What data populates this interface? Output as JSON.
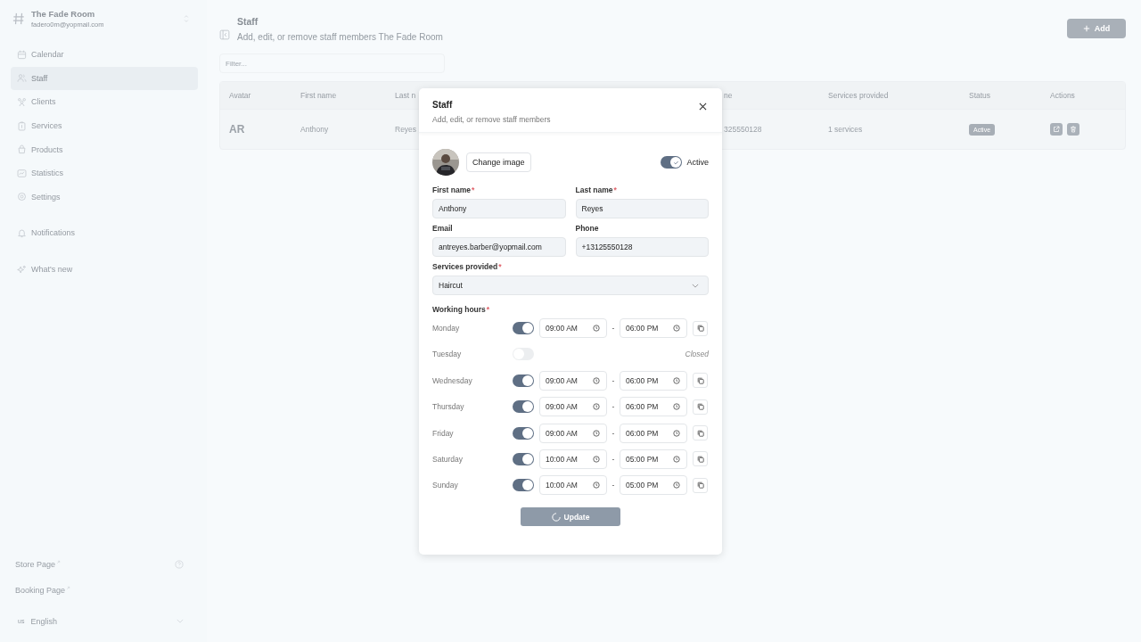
{
  "workspace": {
    "name": "The Fade Room",
    "email": "fadero0m@yopmail.com"
  },
  "sidebar": {
    "items": [
      {
        "label": "Calendar",
        "selected": false
      },
      {
        "label": "Staff",
        "selected": true
      },
      {
        "label": "Clients",
        "selected": false
      },
      {
        "label": "Services",
        "selected": false
      },
      {
        "label": "Products",
        "selected": false
      },
      {
        "label": "Statistics",
        "selected": false
      },
      {
        "label": "Settings",
        "selected": false
      }
    ],
    "notifications": "Notifications",
    "whats_new": "What's new",
    "footer_links": [
      {
        "label": "Store Page"
      },
      {
        "label": "Booking Page"
      }
    ],
    "language": {
      "code": "us",
      "label": "English"
    }
  },
  "header": {
    "title": "Staff",
    "subtitle": "Add, edit, or remove staff members The Fade Room",
    "add_button": "Add"
  },
  "filter": {
    "placeholder": "Filter..."
  },
  "table": {
    "columns": [
      "Avatar",
      "First name",
      "Last n",
      "ne",
      "Services provided",
      "Status",
      "Actions"
    ],
    "rows": [
      {
        "initials": "AR",
        "first_name": "Anthony",
        "last_name": "Reyes",
        "phone": "325550128",
        "services": "1 services",
        "status": "Active"
      }
    ]
  },
  "modal": {
    "title": "Staff",
    "subtitle": "Add, edit, or remove staff members",
    "change_image": "Change image",
    "active": {
      "label": "Active",
      "on": true
    },
    "required_mark": "*",
    "fields": [
      {
        "label": "First name",
        "required": true,
        "value": "Anthony"
      },
      {
        "label": "Last name",
        "required": true,
        "value": "Reyes"
      },
      {
        "label": "Email",
        "required": false,
        "value": "antreyes.barber@yopmail.com"
      },
      {
        "label": "Phone",
        "required": false,
        "value": "+13125550128"
      }
    ],
    "services": {
      "label": "Services provided",
      "required": true,
      "value": "Haircut"
    },
    "working_hours": {
      "label": "Working hours",
      "required": true,
      "separator": "-",
      "days": [
        {
          "day": "Monday",
          "open": true,
          "start": "09:00 AM",
          "end": "06:00 PM"
        },
        {
          "day": "Tuesday",
          "open": false,
          "closed_label": "Closed"
        },
        {
          "day": "Wednesday",
          "open": true,
          "start": "09:00 AM",
          "end": "06:00 PM"
        },
        {
          "day": "Thursday",
          "open": true,
          "start": "09:00 AM",
          "end": "06:00 PM"
        },
        {
          "day": "Friday",
          "open": true,
          "start": "09:00 AM",
          "end": "06:00 PM"
        },
        {
          "day": "Saturday",
          "open": true,
          "start": "10:00 AM",
          "end": "05:00 PM"
        },
        {
          "day": "Sunday",
          "open": true,
          "start": "10:00 AM",
          "end": "05:00 PM"
        }
      ]
    },
    "submit": {
      "label": "Update",
      "loading": true
    }
  }
}
